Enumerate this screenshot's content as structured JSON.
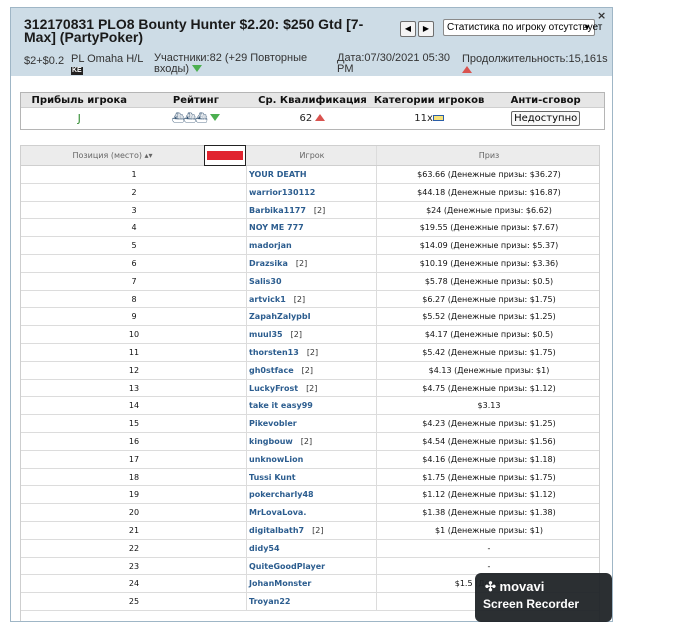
{
  "header": {
    "title": "312170831 PLO8 Bounty Hunter $2.20: $250 Gtd [7-Max] (PartyPoker)",
    "buyin": "$2+$0.2",
    "game_type": "PL Omaha H/L",
    "game_badge": "KE",
    "participants": "Участники:82 (+29 Повторные входы)",
    "date": "Дата:07/30/2021 05:30 PM",
    "duration": "Продолжительность:15,161s",
    "stats_dropdown": "Статистика по игроку отсутствует",
    "prev_label": "◀",
    "next_label": "▶",
    "close_label": "×"
  },
  "stats": {
    "headers": [
      "Прибыль игрока",
      "Рейтинг",
      "Ср. Квалификация",
      "Категории игроков",
      "Анти-сговор"
    ],
    "profit_value": "J",
    "rating_icons": "⛴⛴⛴",
    "avg_qual": "62",
    "categories": "11x",
    "anti_collusion_button": "Недоступно"
  },
  "results": {
    "col_position": "Позиция (место)",
    "col_player": "Игрок",
    "col_prize": "Приз",
    "rows": [
      {
        "pos": "1",
        "player": "YOUR DEATH",
        "rebuys": "",
        "prize": "$63.66  (Денежные призы: $36.27)"
      },
      {
        "pos": "2",
        "player": "warrior130112",
        "rebuys": "",
        "prize": "$44.18  (Денежные призы: $16.87)"
      },
      {
        "pos": "3",
        "player": "Barbika1177",
        "rebuys": "[2]",
        "prize": "$24  (Денежные призы: $6.62)"
      },
      {
        "pos": "4",
        "player": "NOY ME 777",
        "rebuys": "",
        "prize": "$19.55  (Денежные призы: $7.67)"
      },
      {
        "pos": "5",
        "player": "madorjan",
        "rebuys": "",
        "prize": "$14.09  (Денежные призы: $5.37)"
      },
      {
        "pos": "6",
        "player": "Drazsika",
        "rebuys": "[2]",
        "prize": "$10.19  (Денежные призы: $3.36)"
      },
      {
        "pos": "7",
        "player": "Salis30",
        "rebuys": "",
        "prize": "$5.78  (Денежные призы: $0.5)"
      },
      {
        "pos": "8",
        "player": "artvick1",
        "rebuys": "[2]",
        "prize": "$6.27  (Денежные призы: $1.75)"
      },
      {
        "pos": "9",
        "player": "ZapahZalypbI",
        "rebuys": "",
        "prize": "$5.52  (Денежные призы: $1.25)"
      },
      {
        "pos": "10",
        "player": "muul35",
        "rebuys": "[2]",
        "prize": "$4.17  (Денежные призы: $0.5)"
      },
      {
        "pos": "11",
        "player": "thorsten13",
        "rebuys": "[2]",
        "prize": "$5.42  (Денежные призы: $1.75)"
      },
      {
        "pos": "12",
        "player": "gh0stface",
        "rebuys": "[2]",
        "prize": "$4.13  (Денежные призы: $1)"
      },
      {
        "pos": "13",
        "player": "LuckyFrost",
        "rebuys": "[2]",
        "prize": "$4.75  (Денежные призы: $1.12)"
      },
      {
        "pos": "14",
        "player": "take it easy99",
        "rebuys": "",
        "prize": "$3.13"
      },
      {
        "pos": "15",
        "player": "Pikevobler",
        "rebuys": "",
        "prize": "$4.23  (Денежные призы: $1.25)"
      },
      {
        "pos": "16",
        "player": "kingbouw",
        "rebuys": "[2]",
        "prize": "$4.54  (Денежные призы: $1.56)"
      },
      {
        "pos": "17",
        "player": "unknowLion",
        "rebuys": "",
        "prize": "$4.16  (Денежные призы: $1.18)"
      },
      {
        "pos": "18",
        "player": "Tussi Kunt",
        "rebuys": "",
        "prize": "$1.75  (Денежные призы: $1.75)"
      },
      {
        "pos": "19",
        "player": "pokercharly48",
        "rebuys": "",
        "prize": "$1.12  (Денежные призы: $1.12)"
      },
      {
        "pos": "20",
        "player": "MrLovaLova.",
        "rebuys": "",
        "prize": "$1.38  (Денежные призы: $1.38)"
      },
      {
        "pos": "21",
        "player": "digitalbath7",
        "rebuys": "[2]",
        "prize": "$1  (Денежные призы: $1)"
      },
      {
        "pos": "22",
        "player": "didy54",
        "rebuys": "",
        "prize": "-"
      },
      {
        "pos": "23",
        "player": "QuiteGoodPlayer",
        "rebuys": "",
        "prize": "-"
      },
      {
        "pos": "24",
        "player": "JohanMonster",
        "rebuys": "",
        "prize": "$1.5  (Денежные"
      },
      {
        "pos": "25",
        "player": "Troyan22",
        "rebuys": "",
        "prize": ""
      }
    ]
  },
  "watermark": {
    "logo": "movavi",
    "text": "Screen Recorder"
  }
}
